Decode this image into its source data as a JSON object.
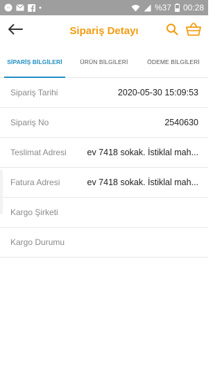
{
  "status_bar": {
    "battery": "%37",
    "time": "00:28"
  },
  "header": {
    "title": "Sipariş Detayı"
  },
  "tabs": [
    {
      "label": "SİPARİŞ BİLGİLERİ",
      "active": true
    },
    {
      "label": "ÜRÜN BİLGİLERİ",
      "active": false
    },
    {
      "label": "ÖDEME BİLGİLERİ",
      "active": false
    }
  ],
  "details": [
    {
      "label": "Sipariş Tarihi",
      "value": "2020-05-30 15:09:53"
    },
    {
      "label": "Sipariş No",
      "value": "2540630"
    },
    {
      "label": "Teslimat Adresi",
      "value": "ev 7418 sokak. İstiklal mah..."
    },
    {
      "label": "Fatura Adresi",
      "value": "ev 7418 sokak. İstiklal mah..."
    },
    {
      "label": "Kargo Şirketi",
      "value": ""
    },
    {
      "label": "Kargo Durumu",
      "value": ""
    }
  ],
  "colors": {
    "accent": "#f39c12",
    "tab_active": "#1f8dc2",
    "status_bar": "#9e9e9e"
  },
  "icons": [
    "messenger-icon",
    "mail-icon",
    "facebook-icon",
    "wifi-icon",
    "signal-icon",
    "battery-icon",
    "back-arrow-icon",
    "search-icon",
    "basket-icon"
  ]
}
